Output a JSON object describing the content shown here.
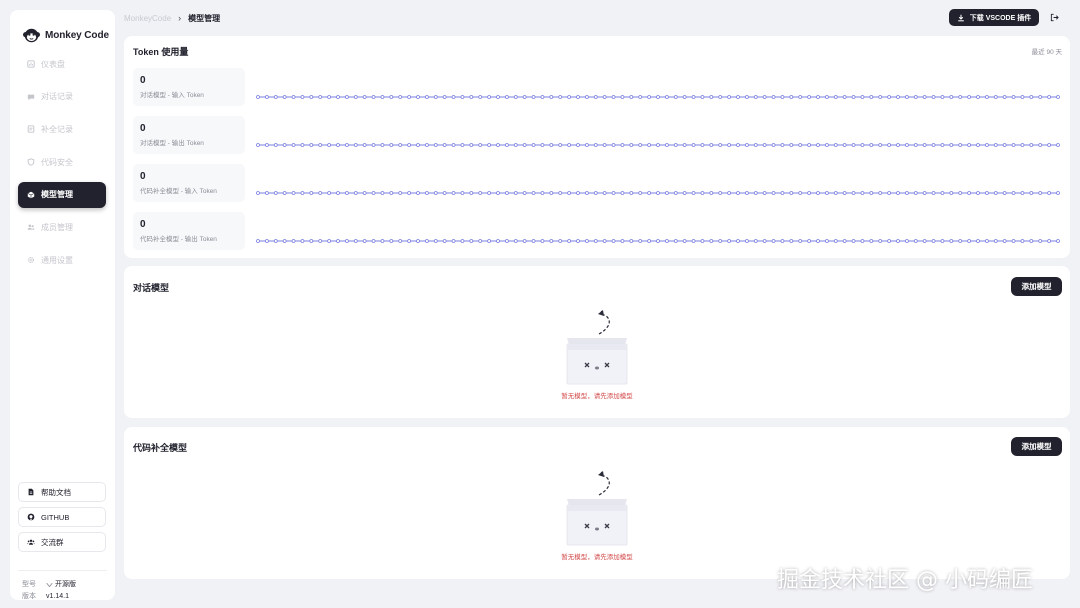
{
  "app": {
    "name": "Monkey Code",
    "version": "v1.14.1",
    "edition": "开源版"
  },
  "sidebar": {
    "items": [
      {
        "label": "仪表盘",
        "icon": "dashboard-icon",
        "active": false
      },
      {
        "label": "对话记录",
        "icon": "chat-icon",
        "active": false
      },
      {
        "label": "补全记录",
        "icon": "completion-icon",
        "active": false
      },
      {
        "label": "代码安全",
        "icon": "shield-icon",
        "active": false
      },
      {
        "label": "模型管理",
        "icon": "cube-icon",
        "active": true
      },
      {
        "label": "成员管理",
        "icon": "users-icon",
        "active": false
      },
      {
        "label": "通用设置",
        "icon": "gear-icon",
        "active": false
      }
    ],
    "links": [
      {
        "label": "帮助文档",
        "icon": "doc-icon"
      },
      {
        "label": "GITHUB",
        "icon": "github-icon"
      },
      {
        "label": "交流群",
        "icon": "group-icon"
      }
    ],
    "meta_edition_key": "型号",
    "meta_version_key": "版本"
  },
  "header": {
    "breadcrumb_root": "MonkeyCode",
    "breadcrumb_current": "模型管理",
    "download_label": "下载 VSCODE 插件"
  },
  "token_usage": {
    "title": "Token 使用量",
    "range": "最近 90 天",
    "stats": [
      {
        "value": "0",
        "label": "对话模型 - 输入 Token"
      },
      {
        "value": "0",
        "label": "对话模型 - 输出 Token"
      },
      {
        "value": "0",
        "label": "代码补全模型 - 输入 Token"
      },
      {
        "value": "0",
        "label": "代码补全模型 - 输出 Token"
      }
    ]
  },
  "chat_models": {
    "title": "对话模型",
    "add_label": "添加模型",
    "empty_text": "暂无模型，请先添加模型"
  },
  "code_models": {
    "title": "代码补全模型",
    "add_label": "添加模型",
    "empty_text": "暂无模型，请先添加模型"
  },
  "watermark": "掘金技术社区 @ 小码编匠",
  "colors": {
    "primary": "#21222d",
    "line": "#7b7fe0",
    "empty_text": "#d34a4a"
  }
}
